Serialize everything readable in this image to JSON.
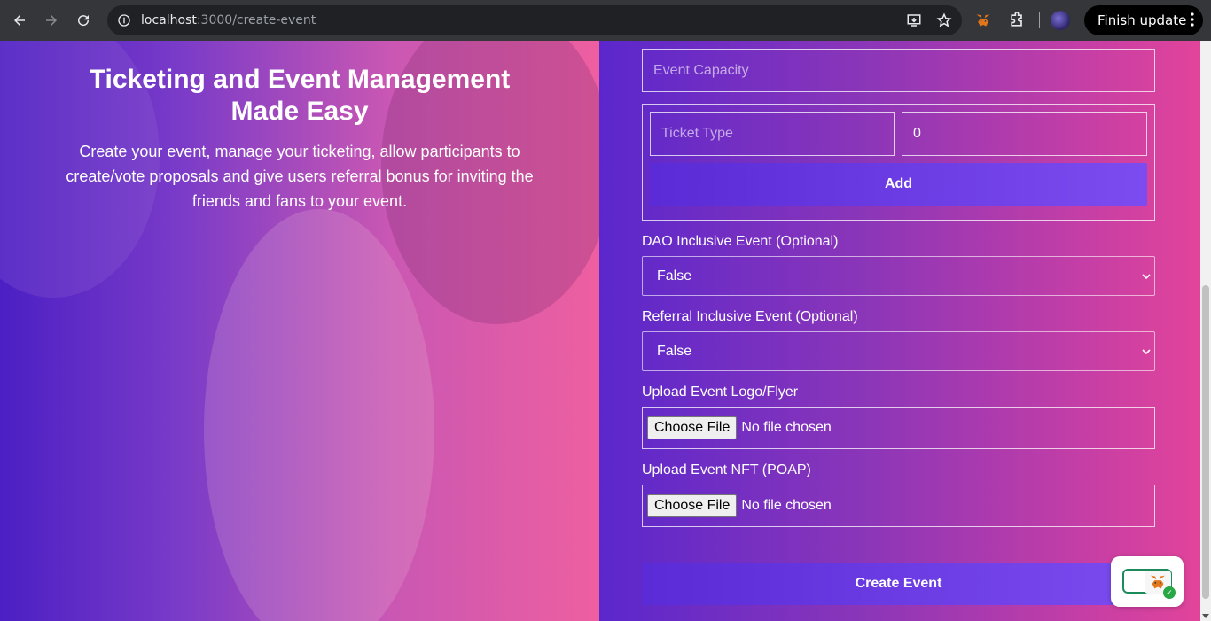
{
  "browser": {
    "url_host": "localhost",
    "url_path": ":3000/create-event",
    "finish_update_label": "Finish update"
  },
  "hero": {
    "title": "Ticketing and Event Management Made Easy",
    "description": "Create your event, manage your ticketing, allow participants to create/vote proposals and give users referral bonus for inviting the friends and fans to your event."
  },
  "form": {
    "capacity_placeholder": "Event Capacity",
    "ticket_type_placeholder": "Ticket Type",
    "ticket_price_value": "0",
    "add_label": "Add",
    "dao_label": "DAO Inclusive Event (Optional)",
    "dao_value": "False",
    "referral_label": "Referral Inclusive Event (Optional)",
    "referral_value": "False",
    "logo_label": "Upload Event Logo/Flyer",
    "nft_label": "Upload Event NFT (POAP)",
    "choose_file_label": "Choose File",
    "no_file_label": "No file chosen",
    "create_label": "Create Event"
  }
}
